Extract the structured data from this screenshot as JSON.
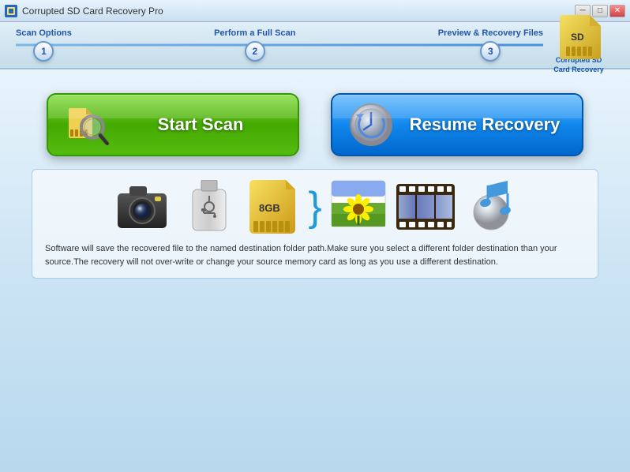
{
  "titleBar": {
    "appName": "Corrupted SD Card Recovery Pro",
    "controls": {
      "minimize": "─",
      "maximize": "□",
      "close": "✕"
    }
  },
  "steps": [
    {
      "number": "1",
      "label": "Scan Options"
    },
    {
      "number": "2",
      "label": "Perform a Full Scan"
    },
    {
      "number": "3",
      "label": "Preview & Recovery Files"
    }
  ],
  "logo": {
    "line1": "Corrupted SD",
    "line2": "Card Recovery"
  },
  "buttons": {
    "startScan": "Start Scan",
    "resumeRecovery": "Resume Recovery"
  },
  "infoText": "Software will save the recovered file to the named destination folder path.Make sure you select a different folder destination than your source.The recovery will not over-write or change your source memory card as long as you use a different destination."
}
